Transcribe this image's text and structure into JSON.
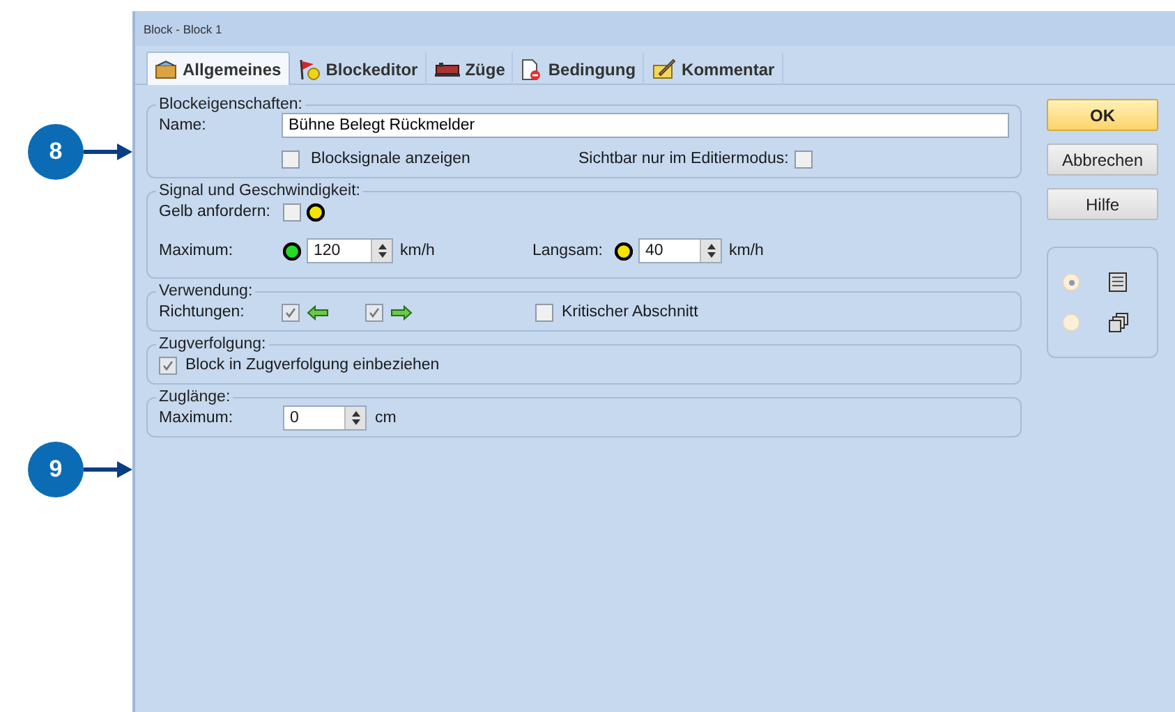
{
  "callouts": [
    {
      "number": "8"
    },
    {
      "number": "9"
    }
  ],
  "window": {
    "title": "Block - Block 1"
  },
  "tabs": [
    {
      "label": "Allgemeines",
      "selected": true,
      "kind": "general"
    },
    {
      "label": "Blockeditor",
      "selected": false,
      "kind": "editor"
    },
    {
      "label": "Züge",
      "selected": false,
      "kind": "trains"
    },
    {
      "label": "Bedingung",
      "selected": false,
      "kind": "condition"
    },
    {
      "label": "Kommentar",
      "selected": false,
      "kind": "comment"
    }
  ],
  "block_properties": {
    "title": "Blockeigenschaften:",
    "name_label": "Name:",
    "name_value": "Bühne Belegt Rückmelder",
    "show_signals": {
      "label": "Blocksignale anzeigen",
      "checked": false
    },
    "edit_mode_only": {
      "label": "Sichtbar nur im Editiermodus:",
      "checked": false
    }
  },
  "signal_speed": {
    "title": "Signal und Geschwindigkeit:",
    "request_yellow": {
      "label": "Gelb anfordern:",
      "checked": false
    },
    "maximum": {
      "label": "Maximum:",
      "value": "120",
      "unit": "km/h"
    },
    "slow": {
      "label": "Langsam:",
      "value": "40",
      "unit": "km/h"
    }
  },
  "usage": {
    "title": "Verwendung:",
    "directions_label": "Richtungen:",
    "directions": [
      {
        "kind": "left",
        "checked": true
      },
      {
        "kind": "right",
        "checked": true
      }
    ],
    "critical": {
      "label": "Kritischer Abschnitt",
      "checked": false
    }
  },
  "train_tracking": {
    "title": "Zugverfolgung:",
    "include": {
      "label": "Block in Zugverfolgung einbeziehen",
      "checked": true
    }
  },
  "train_length": {
    "title": "Zuglänge:",
    "maximum": {
      "label": "Maximum:",
      "value": "0",
      "unit": "cm"
    }
  },
  "buttons": [
    {
      "label": "OK",
      "kind": "default"
    },
    {
      "label": "Abbrechen",
      "kind": "normal"
    },
    {
      "label": "Hilfe",
      "kind": "normal"
    }
  ],
  "view_options": [
    {
      "kind": "single",
      "selected": true
    },
    {
      "kind": "multiple",
      "selected": false
    }
  ]
}
